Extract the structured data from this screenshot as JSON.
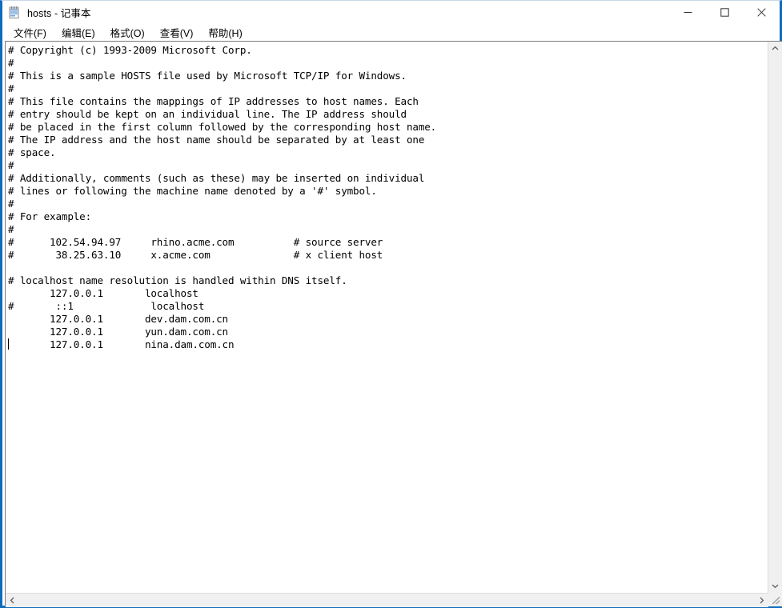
{
  "window": {
    "title": "hosts - 记事本",
    "icon": "notepad-icon",
    "accent_color": "#0f6cbd",
    "controls": {
      "minimize": "—",
      "maximize": "▢",
      "close": "✕",
      "minimize_name": "minimize",
      "maximize_name": "maximize",
      "close_name": "close"
    }
  },
  "menu": {
    "items": [
      {
        "label": "文件(F)",
        "name": "menu-file"
      },
      {
        "label": "编辑(E)",
        "name": "menu-edit"
      },
      {
        "label": "格式(O)",
        "name": "menu-format"
      },
      {
        "label": "查看(V)",
        "name": "menu-view"
      },
      {
        "label": "帮助(H)",
        "name": "menu-help"
      }
    ]
  },
  "editor": {
    "font": "monospace",
    "caret_line": 28,
    "lines": [
      "# Copyright (c) 1993-2009 Microsoft Corp.",
      "#",
      "# This is a sample HOSTS file used by Microsoft TCP/IP for Windows.",
      "#",
      "# This file contains the mappings of IP addresses to host names. Each",
      "# entry should be kept on an individual line. The IP address should",
      "# be placed in the first column followed by the corresponding host name.",
      "# The IP address and the host name should be separated by at least one",
      "# space.",
      "#",
      "# Additionally, comments (such as these) may be inserted on individual",
      "# lines or following the machine name denoted by a '#' symbol.",
      "#",
      "# For example:",
      "#",
      "#      102.54.94.97     rhino.acme.com          # source server",
      "#       38.25.63.10     x.acme.com              # x client host",
      "",
      "# localhost name resolution is handled within DNS itself.",
      "       127.0.0.1       localhost",
      "#       ::1             localhost",
      "       127.0.0.1       dev.dam.com.cn",
      "       127.0.0.1       yun.dam.com.cn",
      "       127.0.0.1       nina.dam.com.cn",
      ""
    ],
    "text": "# Copyright (c) 1993-2009 Microsoft Corp.\n#\n# This is a sample HOSTS file used by Microsoft TCP/IP for Windows.\n#\n# This file contains the mappings of IP addresses to host names. Each\n# entry should be kept on an individual line. The IP address should\n# be placed in the first column followed by the corresponding host name.\n# The IP address and the host name should be separated by at least one\n# space.\n#\n# Additionally, comments (such as these) may be inserted on individual\n# lines or following the machine name denoted by a '#' symbol.\n#\n# For example:\n#\n#      102.54.94.97     rhino.acme.com          # source server\n#       38.25.63.10     x.acme.com              # x client host\n\n# localhost name resolution is handled within DNS itself.\n       127.0.0.1       localhost\n#       ::1             localhost\n       127.0.0.1       dev.dam.com.cn\n       127.0.0.1       yun.dam.com.cn\n       127.0.0.1       nina.dam.com.cn\n"
  },
  "scrollbars": {
    "vertical": {
      "up_arrow": "˄",
      "down_arrow": "˅"
    },
    "horizontal": {
      "left_arrow": "˂",
      "right_arrow": "˃"
    }
  }
}
